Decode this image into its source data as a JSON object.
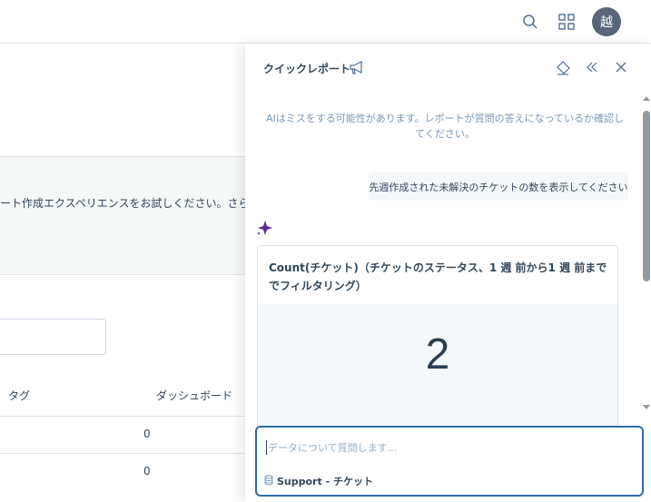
{
  "header": {
    "avatar_text": "越",
    "icons": [
      "search-icon",
      "grid-icon"
    ]
  },
  "main": {
    "banner_text": "ート作成エクスペリエンスをお試しください。さらなる引",
    "table": {
      "columns": [
        "タグ",
        "ダッシュボード"
      ],
      "rows": [
        {
          "dashboards": "0"
        },
        {
          "dashboards": "0"
        }
      ]
    }
  },
  "panel": {
    "title": "クイックレポート",
    "disclaimer": "AIはミスをする可能性があります。レポートが質問の答えになっているか確認してください。",
    "user_message": "先週作成された未解決のチケットの数を表示してください",
    "card": {
      "title": "Count(チケット)（チケットのステータス、1 週 前から1 週 前まででフィルタリング）",
      "value": "2"
    },
    "input": {
      "placeholder": "データについて質問します...",
      "source": "Support - チケット"
    },
    "accent_color": "#2e6da4",
    "sparkle_color": "#5b2a9e"
  }
}
